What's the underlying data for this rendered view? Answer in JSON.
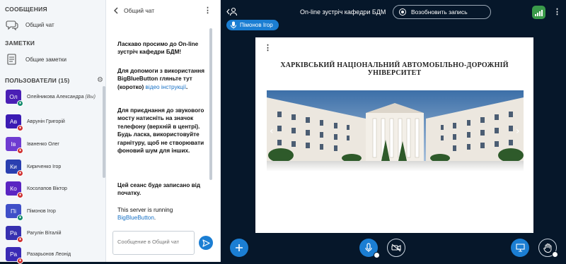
{
  "sidebar": {
    "messages_title": "СООБЩЕНИЯ",
    "public_chat": "Общий чат",
    "notes_title": "ЗАМЕТКИ",
    "shared_notes": "Общие заметки",
    "users_title": "ПОЛЬЗОВАТЕЛИ (15)",
    "users": [
      {
        "initials": "Ол",
        "name": "Олейникова Александра",
        "suffix": " (Вы)",
        "color": "#4a1fb5",
        "badge": "#0f8a6a"
      },
      {
        "initials": "Ав",
        "name": "Аврунін Григорій",
        "suffix": "",
        "color": "#3b1bb3",
        "badge": "#d03030"
      },
      {
        "initials": "Ів",
        "name": "Іваненко Олег",
        "suffix": "",
        "color": "#6e3bd1",
        "badge": "#d03030"
      },
      {
        "initials": "Ки",
        "name": "Кириченко Ігор",
        "suffix": "",
        "color": "#2a3fb0",
        "badge": "#d03030"
      },
      {
        "initials": "Ко",
        "name": "Косолапов Віктор",
        "suffix": "",
        "color": "#5a25c2",
        "badge": "#d03030"
      },
      {
        "initials": "Пі",
        "name": "Пімонов Ігор",
        "suffix": "",
        "color": "#3f4fc8",
        "badge": "#0f8a6a"
      },
      {
        "initials": "Ра",
        "name": "Рагулін Віталій",
        "suffix": "",
        "color": "#3730b0",
        "badge": "#d03030"
      },
      {
        "initials": "Ра",
        "name": "Разарьонов Леонід",
        "suffix": "",
        "color": "#3a2ab5",
        "badge": "#d03030"
      }
    ]
  },
  "chat": {
    "title": "Общий чат",
    "welcome_1": "Ласкаво просимо до On-line зустріч кафедри БДМ!",
    "help_text": "Для допомоги з використання BigBlueButton гляньте тут (коротко) ",
    "help_link": "відео інструкції",
    "help_end": ".",
    "audio_text": "Для приєднання до звукового мосту натисніть на значок телефону (верхній в центрі). Будь ласка, використовуйте гарнітуру, щоб не створювати фоновий шум для інших.",
    "recording_text": "Цей сеанс буде записано від початку.",
    "server_text": "This server is running ",
    "server_link": "BigBlueButton",
    "server_end": ".",
    "input_placeholder": "Сообщение в Общий чат"
  },
  "main": {
    "meeting_title": "On-line зустріч кафедри БДМ",
    "resume_recording": "Возобновить запись",
    "presenter_name": "Пімонов Ігор",
    "slide_title": "ХАРКІВСЬКИЙ НАЦІОНАЛЬНИЙ АВТОМОБІЛЬНО-ДОРОЖНІЙ УНІВЕРСИТЕТ"
  },
  "colors": {
    "accent": "#1b7ed3",
    "background": "#06172a",
    "connection": "#3a9a4a"
  },
  "icons": [
    "chat-bubbles-icon",
    "notes-icon",
    "gear-icon",
    "back-icon",
    "kebab-icon",
    "send-icon",
    "user-list-icon",
    "record-icon",
    "connection-icon",
    "mic-icon",
    "camera-off-icon",
    "plus-icon",
    "presentation-icon",
    "raise-hand-icon"
  ]
}
